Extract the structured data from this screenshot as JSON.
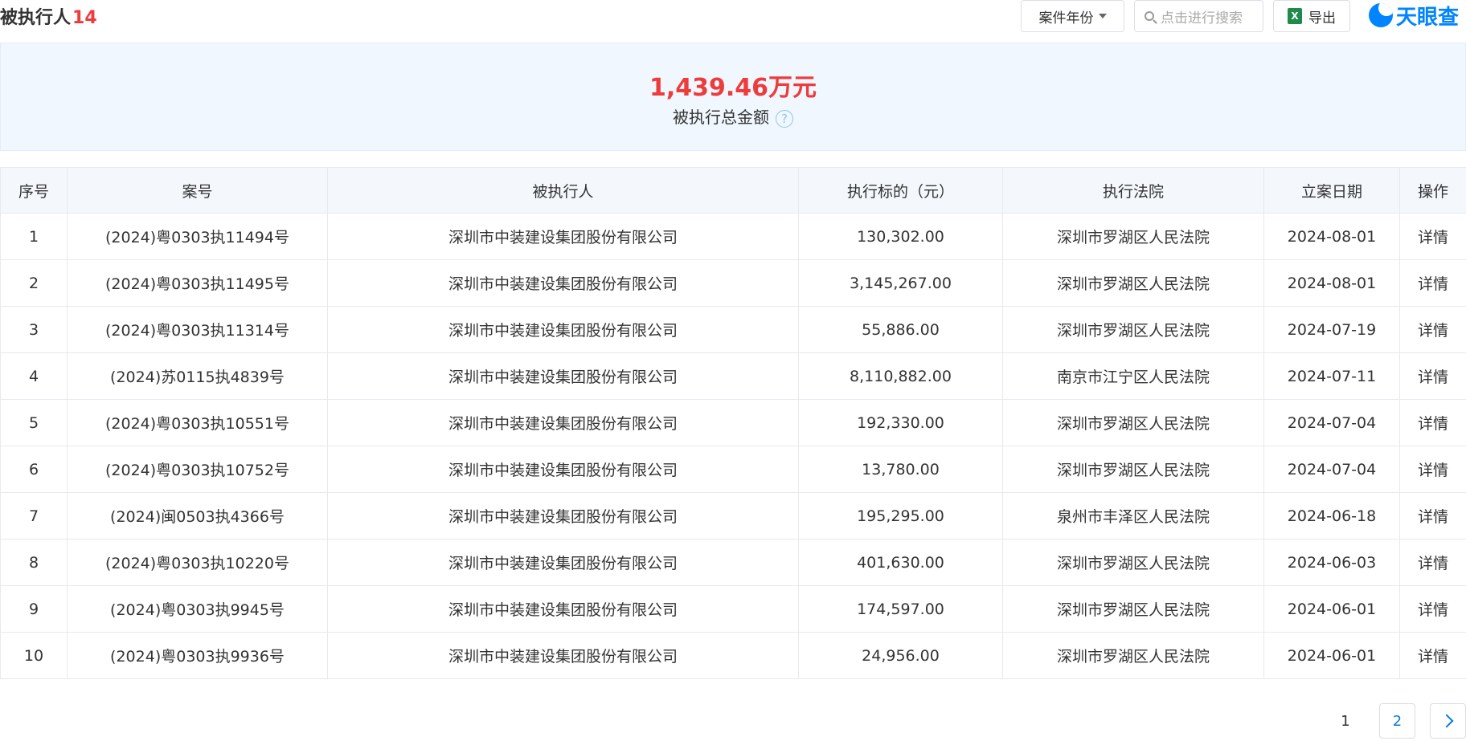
{
  "header": {
    "title": "被执行人",
    "count": "14",
    "year_filter_label": "案件年份",
    "search_placeholder": "点击进行搜索",
    "export_label": "导出",
    "logo_text": "天眼查"
  },
  "summary": {
    "amount": "1,439.46万元",
    "label": "被执行总金额",
    "help": "?"
  },
  "table": {
    "columns": [
      "序号",
      "案号",
      "被执行人",
      "执行标的（元）",
      "执行法院",
      "立案日期",
      "操作"
    ],
    "rows": [
      {
        "no": "1",
        "case": "(2024)粤0303执11494号",
        "party": "深圳市中装建设集团股份有限公司",
        "amount": "130,302.00",
        "court": "深圳市罗湖区人民法院",
        "date": "2024-08-01",
        "action": "详情"
      },
      {
        "no": "2",
        "case": "(2024)粤0303执11495号",
        "party": "深圳市中装建设集团股份有限公司",
        "amount": "3,145,267.00",
        "court": "深圳市罗湖区人民法院",
        "date": "2024-08-01",
        "action": "详情"
      },
      {
        "no": "3",
        "case": "(2024)粤0303执11314号",
        "party": "深圳市中装建设集团股份有限公司",
        "amount": "55,886.00",
        "court": "深圳市罗湖区人民法院",
        "date": "2024-07-19",
        "action": "详情"
      },
      {
        "no": "4",
        "case": "(2024)苏0115执4839号",
        "party": "深圳市中装建设集团股份有限公司",
        "amount": "8,110,882.00",
        "court": "南京市江宁区人民法院",
        "date": "2024-07-11",
        "action": "详情"
      },
      {
        "no": "5",
        "case": "(2024)粤0303执10551号",
        "party": "深圳市中装建设集团股份有限公司",
        "amount": "192,330.00",
        "court": "深圳市罗湖区人民法院",
        "date": "2024-07-04",
        "action": "详情"
      },
      {
        "no": "6",
        "case": "(2024)粤0303执10752号",
        "party": "深圳市中装建设集团股份有限公司",
        "amount": "13,780.00",
        "court": "深圳市罗湖区人民法院",
        "date": "2024-07-04",
        "action": "详情"
      },
      {
        "no": "7",
        "case": "(2024)闽0503执4366号",
        "party": "深圳市中装建设集团股份有限公司",
        "amount": "195,295.00",
        "court": "泉州市丰泽区人民法院",
        "date": "2024-06-18",
        "action": "详情"
      },
      {
        "no": "8",
        "case": "(2024)粤0303执10220号",
        "party": "深圳市中装建设集团股份有限公司",
        "amount": "401,630.00",
        "court": "深圳市罗湖区人民法院",
        "date": "2024-06-03",
        "action": "详情"
      },
      {
        "no": "9",
        "case": "(2024)粤0303执9945号",
        "party": "深圳市中装建设集团股份有限公司",
        "amount": "174,597.00",
        "court": "深圳市罗湖区人民法院",
        "date": "2024-06-01",
        "action": "详情"
      },
      {
        "no": "10",
        "case": "(2024)粤0303执9936号",
        "party": "深圳市中装建设集团股份有限公司",
        "amount": "24,956.00",
        "court": "深圳市罗湖区人民法院",
        "date": "2024-06-01",
        "action": "详情"
      }
    ]
  },
  "pagination": {
    "current": "1",
    "next_page": "2",
    "next_icon": "chevron-right-icon"
  },
  "colors": {
    "accent": "#0a7bd9",
    "highlight": "#ee3b3b",
    "summary_bg": "#f0f7ff",
    "header_bg": "#f4f8fd"
  }
}
